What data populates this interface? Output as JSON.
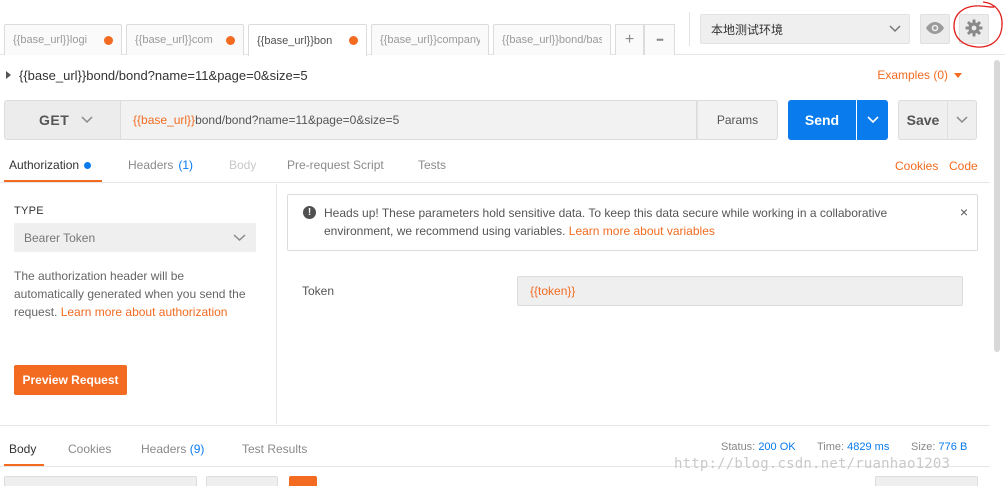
{
  "tabs": [
    {
      "label": "{{base_url}}logi",
      "unsaved": true
    },
    {
      "label": "{{base_url}}com",
      "unsaved": true
    },
    {
      "label": "{{base_url}}bon",
      "unsaved": true,
      "active": true
    },
    {
      "label": "{{base_url}}company",
      "unsaved": false
    },
    {
      "label": "{{base_url}}bond/bas",
      "unsaved": false
    }
  ],
  "tab_actions": {
    "add": "+",
    "more": "•••"
  },
  "environment": {
    "selected": "本地测试环境"
  },
  "request": {
    "title": "{{base_url}}bond/bond?name=11&page=0&size=5",
    "examples_label": "Examples (0)",
    "method": "GET",
    "url_var": "{{base_url}}",
    "url_path": "bond/bond?name=11&page=0&size=5",
    "params_label": "Params",
    "send_label": "Send",
    "save_label": "Save"
  },
  "request_tabs": {
    "authorization": "Authorization",
    "headers": "Headers",
    "headers_count": "(1)",
    "body": "Body",
    "pre_request": "Pre-request Script",
    "tests": "Tests",
    "cookies": "Cookies",
    "code": "Code"
  },
  "auth": {
    "type_heading": "TYPE",
    "type_value": "Bearer Token",
    "description": "The authorization header will be automatically generated when you send the request. ",
    "learn_more": "Learn more about authorization",
    "preview_label": "Preview Request",
    "notice_text": "Heads up! These parameters hold sensitive data. To keep this data secure while working in a collaborative environment, we recommend using variables. ",
    "notice_link": "Learn more about variables",
    "notice_close": "×",
    "token_label": "Token",
    "token_value": "{{token}}"
  },
  "response": {
    "tabs": {
      "body": "Body",
      "cookies": "Cookies",
      "headers": "Headers",
      "headers_count": "(9)",
      "test_results": "Test Results"
    },
    "status_label": "Status:",
    "status_value": "200 OK",
    "time_label": "Time:",
    "time_value": "4829 ms",
    "size_label": "Size:",
    "size_value": "776 B"
  },
  "watermark": "http://blog.csdn.net/ruanhao1203",
  "colors": {
    "accent": "#f26b21",
    "primary": "#097bed",
    "annotation": "#e0201e"
  },
  "icons": {
    "eye": "eye-icon",
    "settings": "gear-icon"
  }
}
